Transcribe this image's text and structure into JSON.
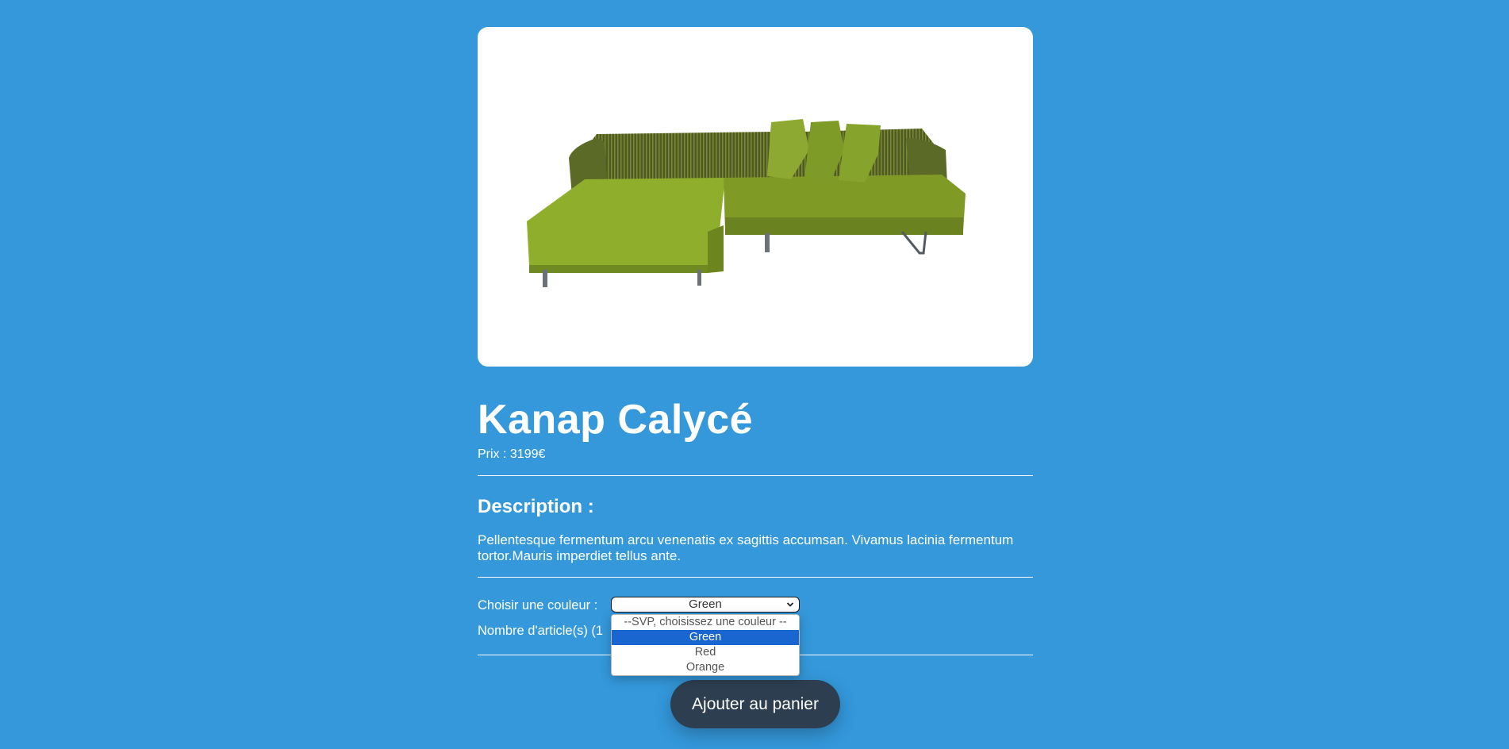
{
  "product": {
    "image_alt": "Photographie d'un canapé vert",
    "name": "Kanap Calycé",
    "price_text": "Prix : 3199€",
    "description_title": "Description :",
    "description": "Pellentesque fermentum arcu venenatis ex sagittis accumsan. Vivamus lacinia fermentum tortor.Mauris imperdiet tellus ante."
  },
  "settings": {
    "color_label": "Choisir une couleur :",
    "color_selected": "Green",
    "color_options": [
      "--SVP, choisissez une couleur --",
      "Green",
      "Red",
      "Orange"
    ],
    "quantity_label": "Nombre d'article(s) (1"
  },
  "cart": {
    "button_label": "Ajouter au panier"
  },
  "colors": {
    "background": "#3498db",
    "button": "#2c3e50",
    "sofa": "#8aa62a",
    "selected_option": "#1a66d1"
  }
}
